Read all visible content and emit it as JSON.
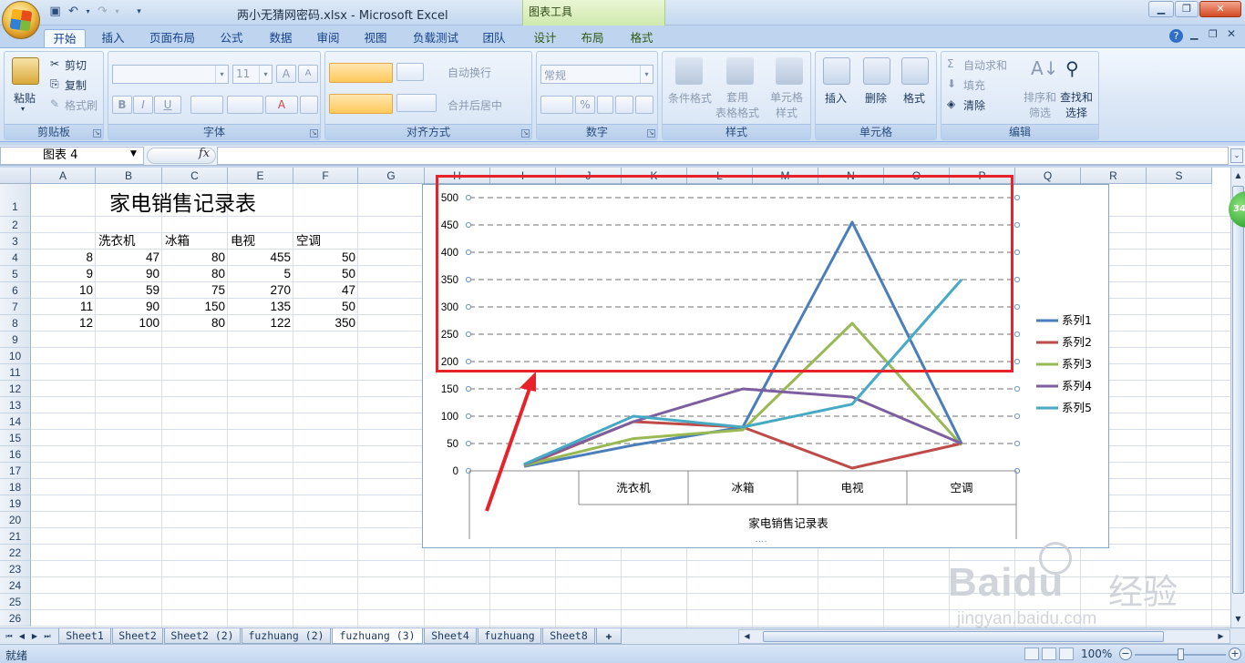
{
  "window": {
    "title": "两小无猜网密码.xlsx - Microsoft Excel",
    "context_tool_title": "图表工具"
  },
  "tabs": [
    {
      "label": "开始",
      "active": true
    },
    {
      "label": "插入"
    },
    {
      "label": "页面布局"
    },
    {
      "label": "公式"
    },
    {
      "label": "数据"
    },
    {
      "label": "审阅"
    },
    {
      "label": "视图"
    },
    {
      "label": "负载测试"
    },
    {
      "label": "团队"
    },
    {
      "label": "设计",
      "context": true
    },
    {
      "label": "布局",
      "context": true
    },
    {
      "label": "格式",
      "context": true
    }
  ],
  "ribbon": {
    "clipboard": {
      "label": "剪贴板",
      "paste": "粘贴",
      "cut": "剪切",
      "copy": "复制",
      "format_painter": "格式刷"
    },
    "font": {
      "label": "字体",
      "size": "11"
    },
    "alignment": {
      "label": "对齐方式",
      "wrap": "自动换行",
      "merge": "合并后居中"
    },
    "number": {
      "label": "数字",
      "format": "常规"
    },
    "styles": {
      "label": "样式",
      "conditional": "条件格式",
      "table_format": "套用\n表格格式",
      "cell_styles": "单元格\n样式"
    },
    "cells": {
      "label": "单元格",
      "insert": "插入",
      "delete": "删除",
      "format": "格式"
    },
    "editing": {
      "label": "编辑",
      "autosum": "自动求和",
      "fill": "填充",
      "clear": "清除",
      "sort_filter": "排序和\n筛选",
      "find_select": "查找和\n选择"
    }
  },
  "formula_bar": {
    "name_box": "图表 4",
    "fx": "fx",
    "formula": ""
  },
  "columns": [
    "A",
    "B",
    "C",
    "E",
    "F",
    "G",
    "H",
    "I",
    "J",
    "K",
    "L",
    "M",
    "N",
    "O",
    "P",
    "Q",
    "R",
    "S"
  ],
  "rows": [
    "1",
    "2",
    "3",
    "4",
    "5",
    "6",
    "7",
    "8",
    "9",
    "10",
    "11",
    "12",
    "13",
    "14",
    "15",
    "16",
    "17",
    "18",
    "19",
    "20",
    "21",
    "22",
    "23",
    "24",
    "25",
    "26"
  ],
  "sheet": {
    "title": "家电销售记录表",
    "headers": [
      "洗衣机",
      "冰箱",
      "电视",
      "空调"
    ],
    "data": [
      [
        8,
        47,
        80,
        455,
        50
      ],
      [
        9,
        90,
        80,
        5,
        50
      ],
      [
        10,
        59,
        75,
        270,
        47
      ],
      [
        11,
        90,
        150,
        135,
        50
      ],
      [
        12,
        100,
        80,
        122,
        350
      ]
    ]
  },
  "chart_data": {
    "type": "line",
    "xlabel": "家电销售记录表",
    "categories": [
      "",
      "洗衣机",
      "冰箱",
      "电视",
      "空调"
    ],
    "ylim": [
      0,
      500
    ],
    "yticks": [
      "0",
      "50",
      "100",
      "150",
      "200",
      "250",
      "300",
      "350",
      "400",
      "450",
      "500"
    ],
    "grid": true,
    "legend": "right",
    "series": [
      {
        "name": "系列1",
        "color": "#4a7ebb",
        "values": [
          8,
          47,
          80,
          455,
          50
        ]
      },
      {
        "name": "系列2",
        "color": "#be4b48",
        "values": [
          9,
          90,
          80,
          5,
          50
        ]
      },
      {
        "name": "系列3",
        "color": "#98b954",
        "values": [
          10,
          59,
          75,
          270,
          47
        ]
      },
      {
        "name": "系列4",
        "color": "#7d5fa0",
        "values": [
          11,
          90,
          150,
          135,
          50
        ]
      },
      {
        "name": "系列5",
        "color": "#46aac5",
        "values": [
          12,
          100,
          80,
          122,
          350
        ]
      }
    ]
  },
  "sheet_tabs": [
    {
      "label": "Sheet1"
    },
    {
      "label": "Sheet2"
    },
    {
      "label": "Sheet2 (2)"
    },
    {
      "label": "fuzhuang (2)"
    },
    {
      "label": "fuzhuang (3)",
      "active": true
    },
    {
      "label": "Sheet4"
    },
    {
      "label": "fuzhuang"
    },
    {
      "label": "Sheet8"
    }
  ],
  "status": {
    "ready": "就绪",
    "zoom": "100%"
  },
  "badge": "34",
  "watermark": {
    "brand": "Baidu",
    "text": "经验",
    "url": "jingyan.baidu.com"
  }
}
